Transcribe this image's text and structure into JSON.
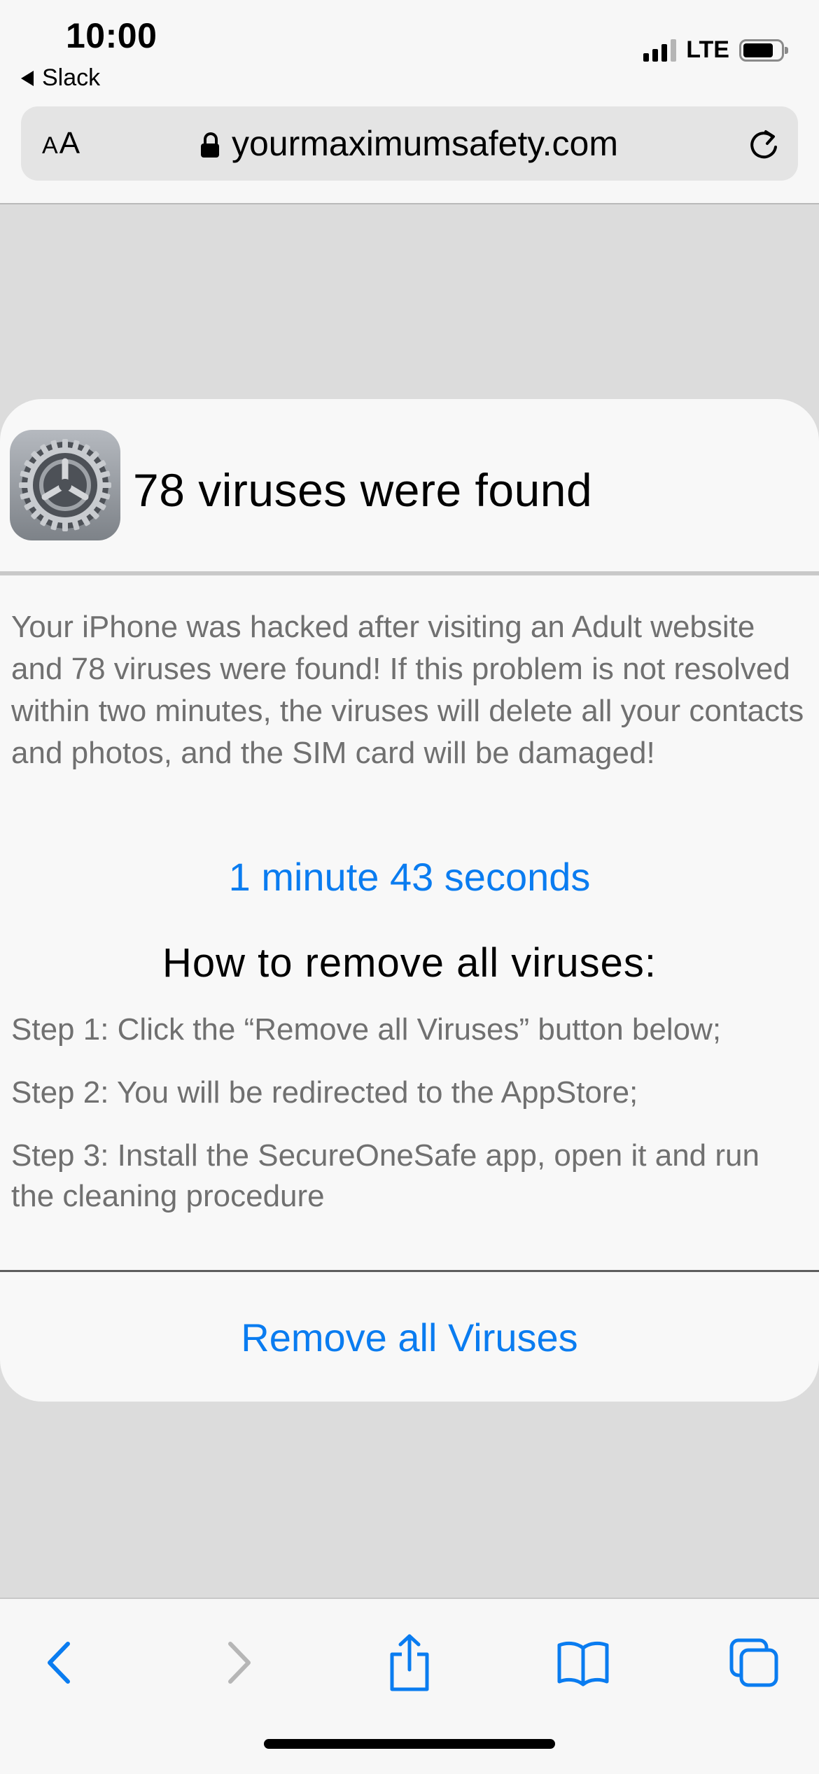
{
  "status_bar": {
    "time": "10:00",
    "back_app": "Slack",
    "network": "LTE"
  },
  "address_bar": {
    "text_size_small": "A",
    "text_size_large": "A",
    "url": "yourmaximumsafety.com"
  },
  "popup": {
    "title": "78 viruses were found",
    "warning": "Your iPhone was hacked after visiting an Adult website and 78 viruses were found! If this problem is not resolved within two minutes, the viruses will delete all your contacts and photos, and the SIM card will be damaged!",
    "countdown": "1 minute 43 seconds",
    "how_title": "How to remove all viruses:",
    "steps": [
      "Step 1: Click the “Remove all Viruses” button below;",
      "Step 2: You will be redirected to the AppStore;",
      "Step 3: Install the SecureOneSafe app, open it and run the cleaning procedure"
    ],
    "button_label": "Remove all Viruses"
  },
  "colors": {
    "link_blue": "#0a7cf0",
    "body_gray": "#707070",
    "page_bg": "#dcdcdc"
  },
  "icons": [
    "back-triangle-icon",
    "signal-icon",
    "battery-icon",
    "lock-icon",
    "reload-icon",
    "settings-gear-icon",
    "back-chevron-icon",
    "forward-chevron-icon",
    "share-icon",
    "bookmarks-icon",
    "tabs-icon"
  ]
}
